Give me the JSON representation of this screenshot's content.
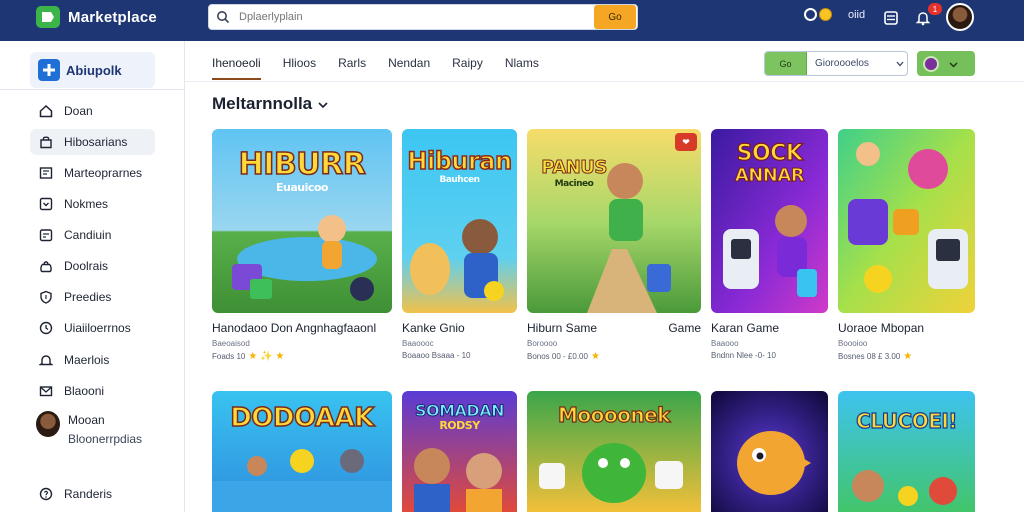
{
  "app": {
    "brand": "Marketplace",
    "search_placeholder": "Dplaerlyplain",
    "search_button": "Go",
    "coin_label": "oiid",
    "notification_count": "1"
  },
  "sidebar": {
    "brand_label": "Abiupolk",
    "items": [
      {
        "label": "Doan",
        "icon": "home-icon"
      },
      {
        "label": "Hibosarians",
        "icon": "store-icon",
        "active": true
      },
      {
        "label": "Marteoprarnes",
        "icon": "grid-icon"
      },
      {
        "label": "Nokmes",
        "icon": "download-icon"
      },
      {
        "label": "Candiuin",
        "icon": "calendar-icon"
      },
      {
        "label": "Doolrais",
        "icon": "bag-icon"
      },
      {
        "label": "Preedies",
        "icon": "shield-icon"
      },
      {
        "label": "Uiaiiloerrnos",
        "icon": "clock-icon"
      },
      {
        "label": "Maerlois",
        "icon": "bell-icon"
      },
      {
        "label": "Blaooni",
        "icon": "mail-icon"
      }
    ],
    "user": {
      "name": "Mooan",
      "subtitle": "Bloonerrpdias"
    },
    "footer_item": {
      "label": "Randeris",
      "icon": "help-icon"
    }
  },
  "tabs": [
    {
      "label": "Ihenoeoli",
      "active": true
    },
    {
      "label": "Hlioos"
    },
    {
      "label": "Rarls"
    },
    {
      "label": "Nendan"
    },
    {
      "label": "Raipy"
    },
    {
      "label": "Nlams"
    }
  ],
  "filter": {
    "left_label": "Go",
    "text": "Gioroooelos"
  },
  "section": {
    "title": "Meltarnnolla"
  },
  "games_row1": [
    {
      "title": "Hanodaoo Don Angnhagfaaonl",
      "extra": "",
      "sub": "Baeoaisod",
      "meta": "Foads 10",
      "stars": "★ ✨ ★",
      "thumb_text": "HIBURR",
      "thumb_sub": "Euauicoo",
      "bg1": "#4fb3e8",
      "bg2": "#3e9b3a"
    },
    {
      "title": "Kanke Gnio",
      "extra": "",
      "sub": "Baaoooc",
      "meta": "Boaaoo Bsaaa - 10",
      "stars": "",
      "thumb_text": "Hiburan",
      "thumb_sub": "Bauhcen",
      "bg1": "#38c3f0",
      "bg2": "#f2c14a"
    },
    {
      "title": "Hiburn Same",
      "extra": "Game",
      "sub": "Boroooo",
      "meta": "Bonos 00 - £0.00",
      "stars": "★",
      "thumb_text": "PANUS",
      "thumb_sub": "Macineo",
      "bg1": "#f3d05a",
      "bg2": "#4aa03a",
      "hot": "❤"
    },
    {
      "title": "Karan Game",
      "extra": "",
      "sub": "Baaooo",
      "meta": "Bndnn Nlee -0- 10",
      "stars": "",
      "thumb_text": "SOCK",
      "thumb_sub": "ANNAR",
      "bg1": "#7a3bd6",
      "bg2": "#c23bd6"
    },
    {
      "title": "Uoraoe Mbopan",
      "extra": "",
      "sub": "Boooioo",
      "meta": "Bosnes 08 £ 3.00",
      "stars": "★",
      "thumb_text": "",
      "thumb_sub": "",
      "bg1": "#3fd08a",
      "bg2": "#f0d23a"
    }
  ],
  "games_row2": [
    {
      "thumb_text": "DODOAAK",
      "bg1": "#38c3f0",
      "bg2": "#2f8dde"
    },
    {
      "thumb_text": "SOMADAN",
      "thumb_sub": "RODSY",
      "bg1": "#5a3bd6",
      "bg2": "#e04a3a"
    },
    {
      "thumb_text": "Moooonek",
      "bg1": "#3aa64a",
      "bg2": "#f2c03a"
    },
    {
      "thumb_text": "",
      "bg1": "#1a0f5a",
      "bg2": "#3b2ab0"
    },
    {
      "thumb_text": "CLUCOEI!",
      "bg1": "#3ec3f0",
      "bg2": "#42c56a"
    }
  ],
  "colors": {
    "topbar": "#1f3674",
    "accent": "#f5a623",
    "green": "#75c05a"
  }
}
